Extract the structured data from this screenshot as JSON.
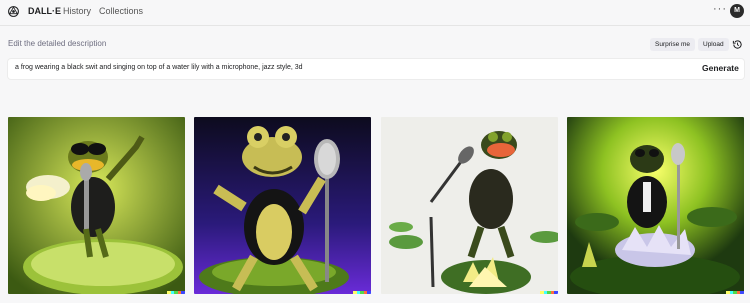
{
  "header": {
    "logo_icon": "openai-logo-icon",
    "brand": "DALL·E",
    "nav": [
      {
        "label": "History"
      },
      {
        "label": "Collections"
      }
    ],
    "more_icon": "more-horizontal-icon",
    "more_glyph": "···",
    "avatar_initial": "M"
  },
  "prompt_area": {
    "label": "Edit the detailed description",
    "surprise_label": "Surprise me",
    "upload_label": "Upload",
    "history_icon": "history-clock-icon",
    "prompt_value": "a frog wearing a black swit and singing on top of a water lily with a microphone, jazz style, 3d",
    "generate_label": "Generate"
  },
  "results": {
    "images": [
      {
        "description": "frog with sunglasses singing on lily pad, green background"
      },
      {
        "description": "frog in black suit with microphone on lily pad, purple background"
      },
      {
        "description": "frog with red lips singing into stand microphone, white background"
      },
      {
        "description": "frog in tuxedo with microphone on water lily, yellow glow"
      }
    ],
    "watermark_colors": [
      "#ffff66",
      "#42ffff",
      "#51da4c",
      "#ff6e3c",
      "#3c46ff"
    ]
  },
  "colors": {
    "background": "#f7f7f8",
    "text_primary": "#202123",
    "text_muted": "#6e6e80",
    "button_bg": "#ececf1"
  }
}
